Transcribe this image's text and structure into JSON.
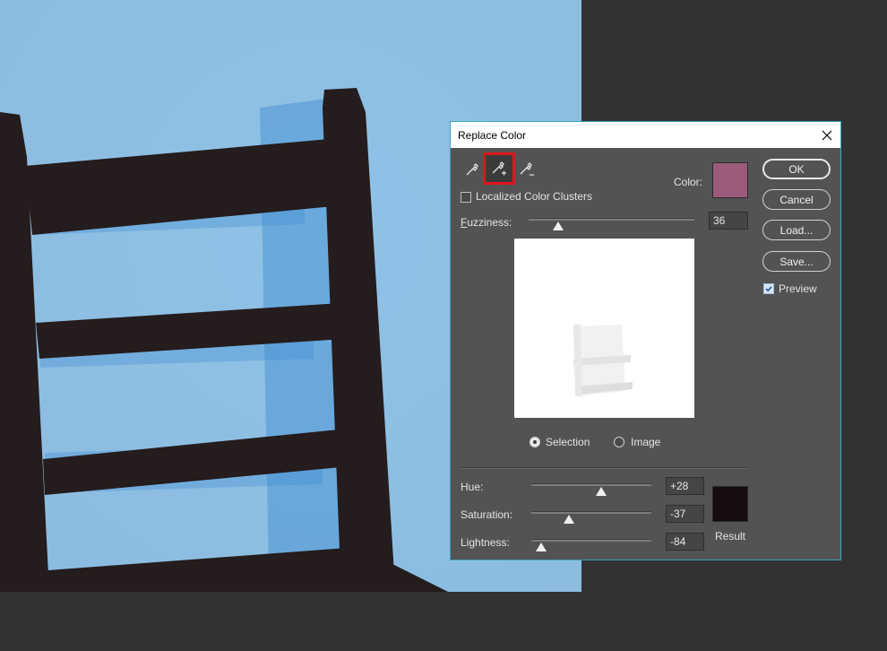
{
  "dialog": {
    "title": "Replace Color",
    "tools": [
      "eyedropper-icon",
      "eyedropper-plus-icon",
      "eyedropper-minus-icon"
    ],
    "localized_label": "Localized Color Clusters",
    "localized_checked": false,
    "color_label": "Color:",
    "color_swatch": "#9c5b7a",
    "fuzziness": {
      "label": "Fuzziness:",
      "underline": "F",
      "value": "36",
      "level": 0.18
    },
    "selection_label": "Selection",
    "image_label": "Image",
    "selected_view": "selection",
    "hue": {
      "label": "Hue:",
      "value": "+28",
      "level": 0.58
    },
    "saturation": {
      "label": "Saturation:",
      "value": "-37",
      "level": 0.315
    },
    "lightness": {
      "label": "Lightness:",
      "value": "-84",
      "level": 0.08
    },
    "result_label": "Result",
    "result_swatch": "#150d0e",
    "buttons": {
      "ok": "OK",
      "cancel": "Cancel",
      "load": "Load...",
      "save": "Save..."
    },
    "preview_label": "Preview",
    "preview_checked": true
  },
  "colors": {
    "accent_border": "#e0141e",
    "sky": "#8fbfe2",
    "chair": "#241c1d"
  }
}
